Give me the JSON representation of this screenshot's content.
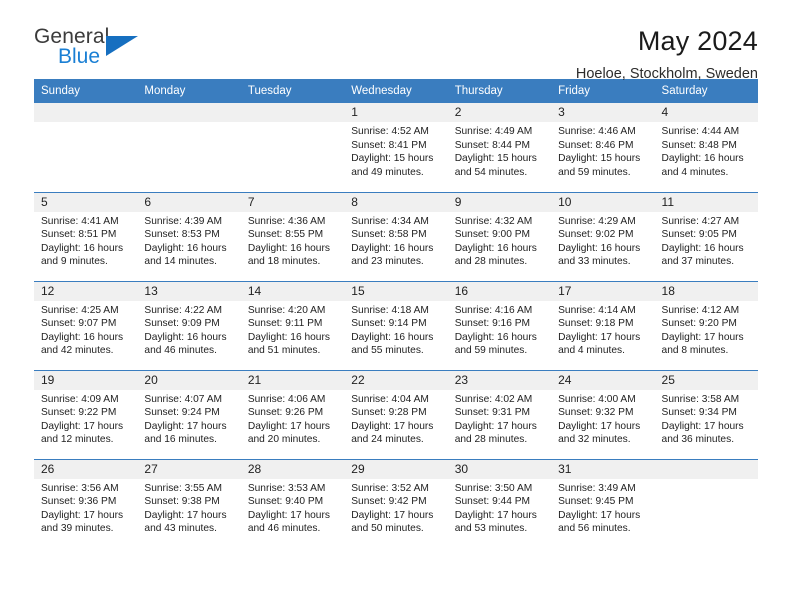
{
  "logo": {
    "word1": "General",
    "word2": "Blue",
    "triangle_color": "#166fc0"
  },
  "header": {
    "title": "May 2024",
    "subtitle": "Hoeloe, Stockholm, Sweden",
    "accent_color": "#3a7dbf"
  },
  "calendar": {
    "weekday_headers": [
      "Sunday",
      "Monday",
      "Tuesday",
      "Wednesday",
      "Thursday",
      "Friday",
      "Saturday"
    ],
    "labels": {
      "sunrise": "Sunrise:",
      "sunset": "Sunset:",
      "daylight": "Daylight:"
    },
    "weeks": [
      [
        {
          "day": "",
          "blank": true
        },
        {
          "day": "",
          "blank": true
        },
        {
          "day": "",
          "blank": true
        },
        {
          "day": "1",
          "sunrise": "Sunrise: 4:52 AM",
          "sunset": "Sunset: 8:41 PM",
          "daylight_line1": "Daylight: 15 hours",
          "daylight_line2": "and 49 minutes."
        },
        {
          "day": "2",
          "sunrise": "Sunrise: 4:49 AM",
          "sunset": "Sunset: 8:44 PM",
          "daylight_line1": "Daylight: 15 hours",
          "daylight_line2": "and 54 minutes."
        },
        {
          "day": "3",
          "sunrise": "Sunrise: 4:46 AM",
          "sunset": "Sunset: 8:46 PM",
          "daylight_line1": "Daylight: 15 hours",
          "daylight_line2": "and 59 minutes."
        },
        {
          "day": "4",
          "sunrise": "Sunrise: 4:44 AM",
          "sunset": "Sunset: 8:48 PM",
          "daylight_line1": "Daylight: 16 hours",
          "daylight_line2": "and 4 minutes."
        }
      ],
      [
        {
          "day": "5",
          "sunrise": "Sunrise: 4:41 AM",
          "sunset": "Sunset: 8:51 PM",
          "daylight_line1": "Daylight: 16 hours",
          "daylight_line2": "and 9 minutes."
        },
        {
          "day": "6",
          "sunrise": "Sunrise: 4:39 AM",
          "sunset": "Sunset: 8:53 PM",
          "daylight_line1": "Daylight: 16 hours",
          "daylight_line2": "and 14 minutes."
        },
        {
          "day": "7",
          "sunrise": "Sunrise: 4:36 AM",
          "sunset": "Sunset: 8:55 PM",
          "daylight_line1": "Daylight: 16 hours",
          "daylight_line2": "and 18 minutes."
        },
        {
          "day": "8",
          "sunrise": "Sunrise: 4:34 AM",
          "sunset": "Sunset: 8:58 PM",
          "daylight_line1": "Daylight: 16 hours",
          "daylight_line2": "and 23 minutes."
        },
        {
          "day": "9",
          "sunrise": "Sunrise: 4:32 AM",
          "sunset": "Sunset: 9:00 PM",
          "daylight_line1": "Daylight: 16 hours",
          "daylight_line2": "and 28 minutes."
        },
        {
          "day": "10",
          "sunrise": "Sunrise: 4:29 AM",
          "sunset": "Sunset: 9:02 PM",
          "daylight_line1": "Daylight: 16 hours",
          "daylight_line2": "and 33 minutes."
        },
        {
          "day": "11",
          "sunrise": "Sunrise: 4:27 AM",
          "sunset": "Sunset: 9:05 PM",
          "daylight_line1": "Daylight: 16 hours",
          "daylight_line2": "and 37 minutes."
        }
      ],
      [
        {
          "day": "12",
          "sunrise": "Sunrise: 4:25 AM",
          "sunset": "Sunset: 9:07 PM",
          "daylight_line1": "Daylight: 16 hours",
          "daylight_line2": "and 42 minutes."
        },
        {
          "day": "13",
          "sunrise": "Sunrise: 4:22 AM",
          "sunset": "Sunset: 9:09 PM",
          "daylight_line1": "Daylight: 16 hours",
          "daylight_line2": "and 46 minutes."
        },
        {
          "day": "14",
          "sunrise": "Sunrise: 4:20 AM",
          "sunset": "Sunset: 9:11 PM",
          "daylight_line1": "Daylight: 16 hours",
          "daylight_line2": "and 51 minutes."
        },
        {
          "day": "15",
          "sunrise": "Sunrise: 4:18 AM",
          "sunset": "Sunset: 9:14 PM",
          "daylight_line1": "Daylight: 16 hours",
          "daylight_line2": "and 55 minutes."
        },
        {
          "day": "16",
          "sunrise": "Sunrise: 4:16 AM",
          "sunset": "Sunset: 9:16 PM",
          "daylight_line1": "Daylight: 16 hours",
          "daylight_line2": "and 59 minutes."
        },
        {
          "day": "17",
          "sunrise": "Sunrise: 4:14 AM",
          "sunset": "Sunset: 9:18 PM",
          "daylight_line1": "Daylight: 17 hours",
          "daylight_line2": "and 4 minutes."
        },
        {
          "day": "18",
          "sunrise": "Sunrise: 4:12 AM",
          "sunset": "Sunset: 9:20 PM",
          "daylight_line1": "Daylight: 17 hours",
          "daylight_line2": "and 8 minutes."
        }
      ],
      [
        {
          "day": "19",
          "sunrise": "Sunrise: 4:09 AM",
          "sunset": "Sunset: 9:22 PM",
          "daylight_line1": "Daylight: 17 hours",
          "daylight_line2": "and 12 minutes."
        },
        {
          "day": "20",
          "sunrise": "Sunrise: 4:07 AM",
          "sunset": "Sunset: 9:24 PM",
          "daylight_line1": "Daylight: 17 hours",
          "daylight_line2": "and 16 minutes."
        },
        {
          "day": "21",
          "sunrise": "Sunrise: 4:06 AM",
          "sunset": "Sunset: 9:26 PM",
          "daylight_line1": "Daylight: 17 hours",
          "daylight_line2": "and 20 minutes."
        },
        {
          "day": "22",
          "sunrise": "Sunrise: 4:04 AM",
          "sunset": "Sunset: 9:28 PM",
          "daylight_line1": "Daylight: 17 hours",
          "daylight_line2": "and 24 minutes."
        },
        {
          "day": "23",
          "sunrise": "Sunrise: 4:02 AM",
          "sunset": "Sunset: 9:31 PM",
          "daylight_line1": "Daylight: 17 hours",
          "daylight_line2": "and 28 minutes."
        },
        {
          "day": "24",
          "sunrise": "Sunrise: 4:00 AM",
          "sunset": "Sunset: 9:32 PM",
          "daylight_line1": "Daylight: 17 hours",
          "daylight_line2": "and 32 minutes."
        },
        {
          "day": "25",
          "sunrise": "Sunrise: 3:58 AM",
          "sunset": "Sunset: 9:34 PM",
          "daylight_line1": "Daylight: 17 hours",
          "daylight_line2": "and 36 minutes."
        }
      ],
      [
        {
          "day": "26",
          "sunrise": "Sunrise: 3:56 AM",
          "sunset": "Sunset: 9:36 PM",
          "daylight_line1": "Daylight: 17 hours",
          "daylight_line2": "and 39 minutes."
        },
        {
          "day": "27",
          "sunrise": "Sunrise: 3:55 AM",
          "sunset": "Sunset: 9:38 PM",
          "daylight_line1": "Daylight: 17 hours",
          "daylight_line2": "and 43 minutes."
        },
        {
          "day": "28",
          "sunrise": "Sunrise: 3:53 AM",
          "sunset": "Sunset: 9:40 PM",
          "daylight_line1": "Daylight: 17 hours",
          "daylight_line2": "and 46 minutes."
        },
        {
          "day": "29",
          "sunrise": "Sunrise: 3:52 AM",
          "sunset": "Sunset: 9:42 PM",
          "daylight_line1": "Daylight: 17 hours",
          "daylight_line2": "and 50 minutes."
        },
        {
          "day": "30",
          "sunrise": "Sunrise: 3:50 AM",
          "sunset": "Sunset: 9:44 PM",
          "daylight_line1": "Daylight: 17 hours",
          "daylight_line2": "and 53 minutes."
        },
        {
          "day": "31",
          "sunrise": "Sunrise: 3:49 AM",
          "sunset": "Sunset: 9:45 PM",
          "daylight_line1": "Daylight: 17 hours",
          "daylight_line2": "and 56 minutes."
        },
        {
          "day": "",
          "blank": true
        }
      ]
    ]
  }
}
